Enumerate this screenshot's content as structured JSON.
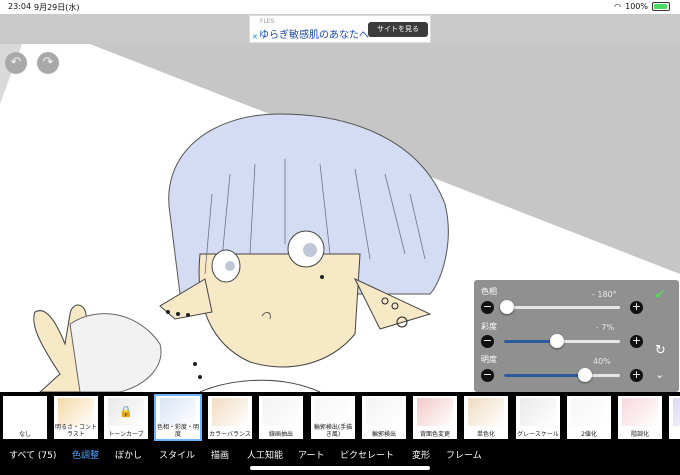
{
  "status": {
    "time": "23:04",
    "date": "9月29日(水)",
    "battery": "100%"
  },
  "ad": {
    "brand": "FLES",
    "text": "ゆらぎ敏感肌のあなたへ",
    "button": "サイトを見る"
  },
  "adjust": {
    "hue": {
      "label": "色相",
      "value": "- 180°",
      "level": 0.03
    },
    "saturation": {
      "label": "彩度",
      "value": "- 7%",
      "level": 0.46
    },
    "brightness": {
      "label": "明度",
      "value": "40%",
      "level": 0.7
    }
  },
  "filters": [
    {
      "label": "なし"
    },
    {
      "label": "明るさ・コントラスト"
    },
    {
      "label": "トーンカーブ"
    },
    {
      "label": "色相・彩度・明度"
    },
    {
      "label": "カラーバランス"
    },
    {
      "label": "線画抽出"
    },
    {
      "label": "輪郭検出(手描き風)"
    },
    {
      "label": "輪郭検出"
    },
    {
      "label": "背面色変更"
    },
    {
      "label": "単色化"
    },
    {
      "label": "グレースケール"
    },
    {
      "label": "2値化"
    },
    {
      "label": "階調化"
    },
    {
      "label": ""
    }
  ],
  "categories": [
    "すべて (75)",
    "色調整",
    "ぼかし",
    "スタイル",
    "描画",
    "人工知能",
    "アート",
    "ピクセレート",
    "変形",
    "フレーム"
  ],
  "active_category": "色調整",
  "colors": {
    "accent": "#4ea3ff",
    "slider_fill": "#2d5a9a",
    "ok": "#5fd45f"
  }
}
